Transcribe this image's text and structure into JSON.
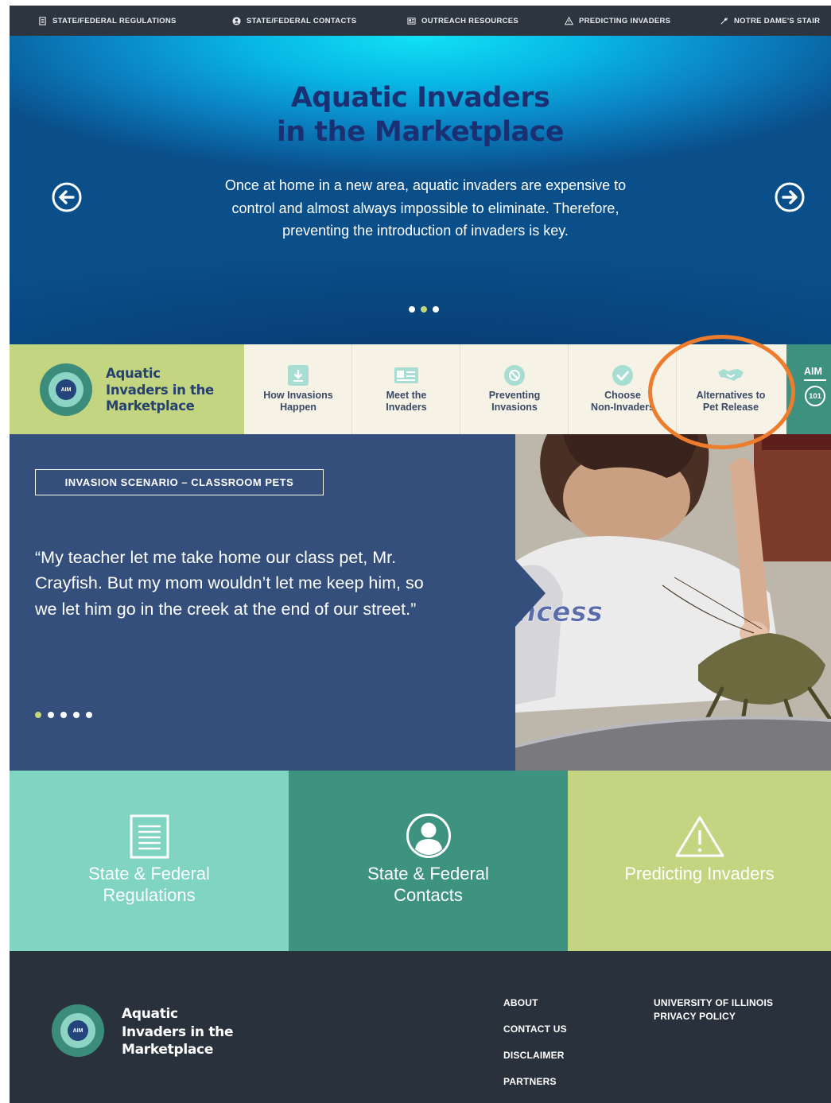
{
  "topnav": {
    "items": [
      {
        "label": "STATE/FEDERAL REGULATIONS",
        "icon": "document-icon"
      },
      {
        "label": "STATE/FEDERAL CONTACTS",
        "icon": "person-circle-icon"
      },
      {
        "label": "OUTREACH RESOURCES",
        "icon": "newspaper-icon"
      },
      {
        "label": "PREDICTING INVADERS",
        "icon": "warning-icon"
      },
      {
        "label": "NOTRE DAME'S STAIR",
        "icon": "wrench-icon"
      }
    ]
  },
  "hero": {
    "title_line1": "Aquatic Invaders",
    "title_line2": "in the Marketplace",
    "text": "Once at home in a new area, aquatic invaders are expensive to control and almost always impossible to eliminate. Therefore, preventing the introduction of invaders is key.",
    "active_slide": 2,
    "slide_count": 3
  },
  "brand": {
    "logo_text": "AIM",
    "line1": "Aquatic",
    "line2": "Invaders in the",
    "line3": "Marketplace"
  },
  "sections": [
    {
      "line1": "How Invasions",
      "line2": "Happen",
      "icon": "download-arrow-icon"
    },
    {
      "line1": "Meet the",
      "line2": "Invaders",
      "icon": "id-card-icon"
    },
    {
      "line1": "Preventing",
      "line2": "Invasions",
      "icon": "prohibited-icon"
    },
    {
      "line1": "Choose",
      "line2": "Non-Invaders",
      "icon": "checkmark-icon"
    },
    {
      "line1": "Alternatives to",
      "line2": "Pet Release",
      "icon": "handshake-icon"
    }
  ],
  "aim101": {
    "top": "AIM",
    "bottom": "101"
  },
  "scenario": {
    "tag": "INVASION SCENARIO – CLASSROOM PETS",
    "quote": "“My teacher let me take home our class pet, Mr. Crayfish. But my mom wouldn’t let me keep him, so we let him go in the creek at the end of our street.”",
    "photo_shirt_text": "ncess",
    "active_slide": 1,
    "slide_count": 5
  },
  "tiles": [
    {
      "line1": "State & Federal",
      "line2": "Regulations",
      "icon": "document-icon",
      "color": "#7fd4c2"
    },
    {
      "line1": "State & Federal",
      "line2": "Contacts",
      "icon": "person-circle-icon",
      "color": "#3e9380"
    },
    {
      "line1": "Predicting Invaders",
      "line2": "",
      "icon": "warning-icon",
      "color": "#c3d580"
    }
  ],
  "footer": {
    "brand_line1": "Aquatic",
    "brand_line2": "Invaders in the",
    "brand_line3": "Marketplace",
    "logo_text": "AIM",
    "links_col1": [
      "ABOUT",
      "CONTACT US",
      "DISCLAIMER",
      "PARTNERS"
    ],
    "links_col2": [
      "UNIVERSITY OF ILLINOIS",
      "PRIVACY POLICY"
    ]
  },
  "colors": {
    "topnav_bg": "#2d3640",
    "hero_title": "#1b2f73",
    "brand_green": "#c3d580",
    "scenario_bg": "#344f7b",
    "teal": "#3e9380",
    "mint": "#7fd4c2",
    "footer_bg": "#29323c",
    "highlight": "#ee7c2d"
  }
}
